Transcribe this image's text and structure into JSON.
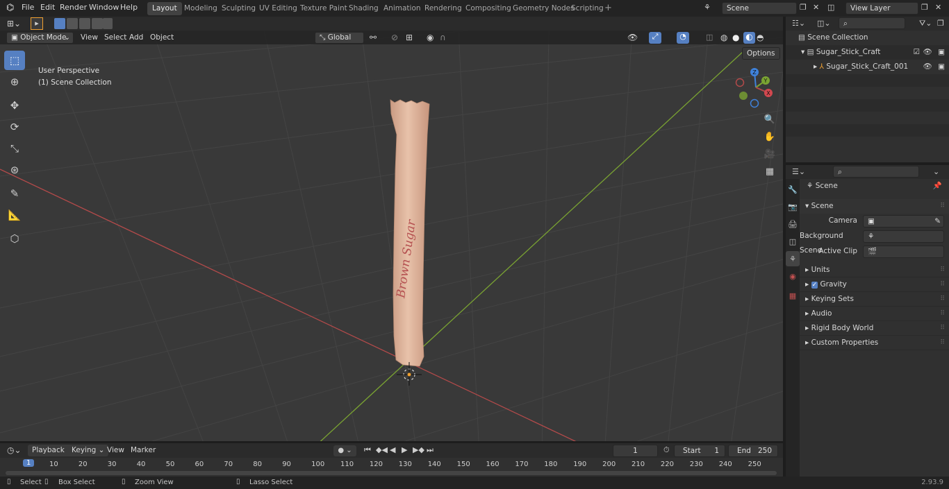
{
  "menu": {
    "file": "File",
    "edit": "Edit",
    "render": "Render",
    "window": "Window",
    "help": "Help"
  },
  "workspaces": [
    {
      "label": "Layout",
      "active": true
    },
    {
      "label": "Modeling"
    },
    {
      "label": "Sculpting"
    },
    {
      "label": "UV Editing"
    },
    {
      "label": "Texture Paint"
    },
    {
      "label": "Shading"
    },
    {
      "label": "Animation"
    },
    {
      "label": "Rendering"
    },
    {
      "label": "Compositing"
    },
    {
      "label": "Geometry Nodes"
    },
    {
      "label": "Scripting"
    }
  ],
  "scene_field": "Scene",
  "view_layer_field": "View Layer",
  "viewport": {
    "mode": "Object Mode",
    "menus": {
      "view": "View",
      "select": "Select",
      "add": "Add",
      "object": "Object"
    },
    "transform": "Global",
    "options": "Options",
    "perspective": "User Perspective",
    "collection": "(1) Scene Collection",
    "object_text": "Brown Sugar",
    "gizmo": {
      "z": "Z",
      "y": "Y",
      "x": "X"
    }
  },
  "timeline": {
    "playback": "Playback",
    "keying": "Keying",
    "view": "View",
    "marker": "Marker",
    "current_frame": "1",
    "start_label": "Start",
    "start": "1",
    "end_label": "End",
    "end": "250",
    "ruler": [
      "1",
      "10",
      "20",
      "30",
      "40",
      "50",
      "60",
      "70",
      "80",
      "90",
      "100",
      "110",
      "120",
      "130",
      "140",
      "150",
      "160",
      "170",
      "180",
      "190",
      "200",
      "210",
      "220",
      "230",
      "240",
      "250"
    ]
  },
  "outliner": {
    "root": "Scene Collection",
    "collection": "Sugar_Stick_Craft",
    "object": "Sugar_Stick_Craft_001"
  },
  "properties": {
    "header": "Scene",
    "section": "Scene",
    "camera_label": "Camera",
    "bg_scene_label": "Background Scene",
    "active_clip_label": "Active Clip",
    "panels": [
      "Units",
      "Gravity",
      "Keying Sets",
      "Audio",
      "Rigid Body World",
      "Custom Properties"
    ]
  },
  "status": {
    "select": "Select",
    "box_select": "Box Select",
    "zoom_view": "Zoom View",
    "lasso_select": "Lasso Select",
    "version": "2.93.9"
  },
  "colors": {
    "accent": "#5680c2",
    "x_axis": "#b34a4a",
    "y_axis": "#7aa332",
    "z_axis": "#3f82db"
  }
}
